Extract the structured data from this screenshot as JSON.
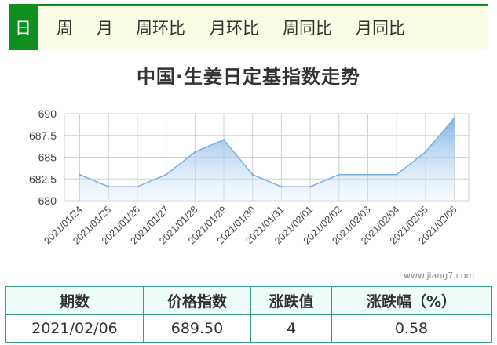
{
  "tabs": [
    "日",
    "周",
    "月",
    "周环比",
    "月环比",
    "周同比",
    "月同比"
  ],
  "active_tab": 0,
  "watermark": "www.jiang7.com",
  "table": {
    "headers": [
      "期数",
      "价格指数",
      "涨跌值",
      "涨跌幅（%）"
    ],
    "row": [
      "2021/02/06",
      "689.50",
      "4",
      "0.58"
    ]
  },
  "colors": {
    "accent": "#0f8f1f",
    "line": "#7ab0e6",
    "table_border": "#3a9a8e"
  },
  "chart_data": {
    "type": "area",
    "title": "中国·生姜日定基指数走势",
    "xlabel": "",
    "ylabel": "",
    "ylim": [
      680,
      690
    ],
    "yticks": [
      "680",
      "682.5",
      "685",
      "687.5",
      "690"
    ],
    "grid": true,
    "categories": [
      "2021/01/24",
      "2021/01/25",
      "2021/01/26",
      "2021/01/27",
      "2021/01/28",
      "2021/01/29",
      "2021/01/30",
      "2021/01/31",
      "2021/02/01",
      "2021/02/02",
      "2021/02/03",
      "2021/02/04",
      "2021/02/05",
      "2021/02/06"
    ],
    "values": [
      683.0,
      681.6,
      681.6,
      683.0,
      685.6,
      687.0,
      683.0,
      681.6,
      681.6,
      683.0,
      683.0,
      683.0,
      685.6,
      689.5
    ]
  }
}
